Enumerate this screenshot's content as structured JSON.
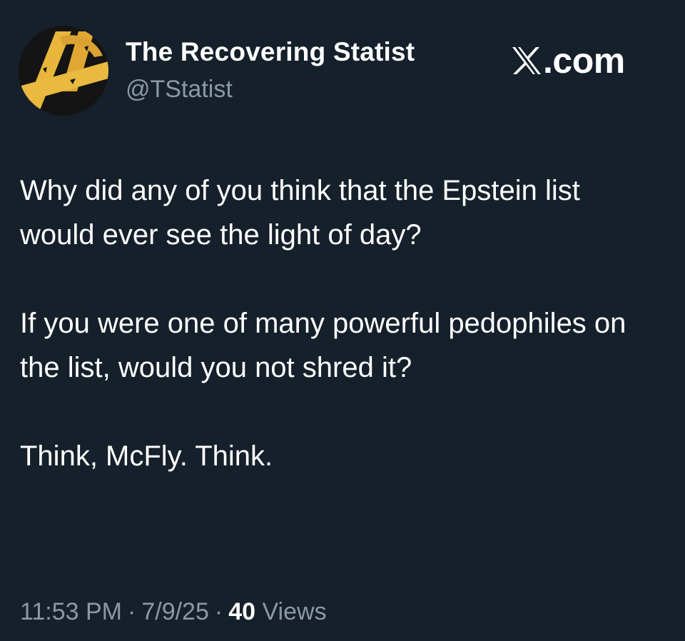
{
  "author": {
    "display_name": "The Recovering Statist",
    "handle": "@TStatist",
    "avatar_icon": "black-circle-with-gold-anarchy-a-icon"
  },
  "brand": {
    "logo_icon": "x-logo-icon",
    "text": ".com"
  },
  "tweet": {
    "paragraphs": [
      "Why did any of you think that the Epstein list would ever see the light of day?",
      "If you were one of many powerful pedophiles on the list, would you not shred it?",
      "Think, McFly. Think."
    ]
  },
  "meta": {
    "time": "11:53 PM",
    "date": "7/9/25",
    "separator": "·",
    "views_count": "40",
    "views_label": "Views"
  },
  "colors": {
    "background": "#15202b",
    "primary_text": "#ffffff",
    "secondary_text": "#8b98a5",
    "avatar_gold": "#e8b63a"
  }
}
